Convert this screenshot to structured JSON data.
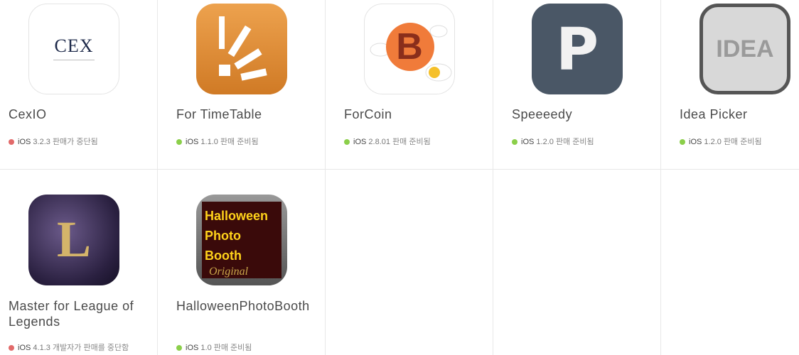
{
  "colors": {
    "active": "#8bcf4a",
    "discontinued": "#e26a6a"
  },
  "apps": [
    {
      "name": "CexIO",
      "platform": "iOS",
      "version": "3.2.3",
      "status": "판매가 중단됨",
      "state": "discontinued",
      "icon": "cex-logo-icon",
      "icon_text": "CEX"
    },
    {
      "name": "For TimeTable",
      "platform": "iOS",
      "version": "1.1.0",
      "status": "판매 준비됨",
      "state": "active",
      "icon": "timetable-icon"
    },
    {
      "name": "ForCoin",
      "platform": "iOS",
      "version": "2.8.01",
      "status": "판매 준비됨",
      "state": "active",
      "icon": "bitcoin-icon",
      "icon_text": "B"
    },
    {
      "name": "Speeeedy",
      "platform": "iOS",
      "version": "1.2.0",
      "status": "판매 준비됨",
      "state": "active",
      "icon": "speedy-p-icon",
      "icon_text": "P"
    },
    {
      "name": "Idea Picker",
      "platform": "iOS",
      "version": "1.2.0",
      "status": "판매 준비됨",
      "state": "active",
      "icon": "idea-icon",
      "icon_text": "IDEA"
    },
    {
      "name": "Master for League of Legends",
      "platform": "iOS",
      "version": "4.1.3",
      "status": "개발자가 판매를 중단함",
      "state": "discontinued",
      "icon": "league-icon",
      "icon_text": "L"
    },
    {
      "name": "HalloweenPhotoBooth",
      "platform": "iOS",
      "version": "1.0",
      "status": "판매 준비됨",
      "state": "active",
      "icon": "halloween-icon",
      "icon_lines": [
        "Halloween",
        "Photo",
        "Booth",
        "Original"
      ]
    }
  ]
}
